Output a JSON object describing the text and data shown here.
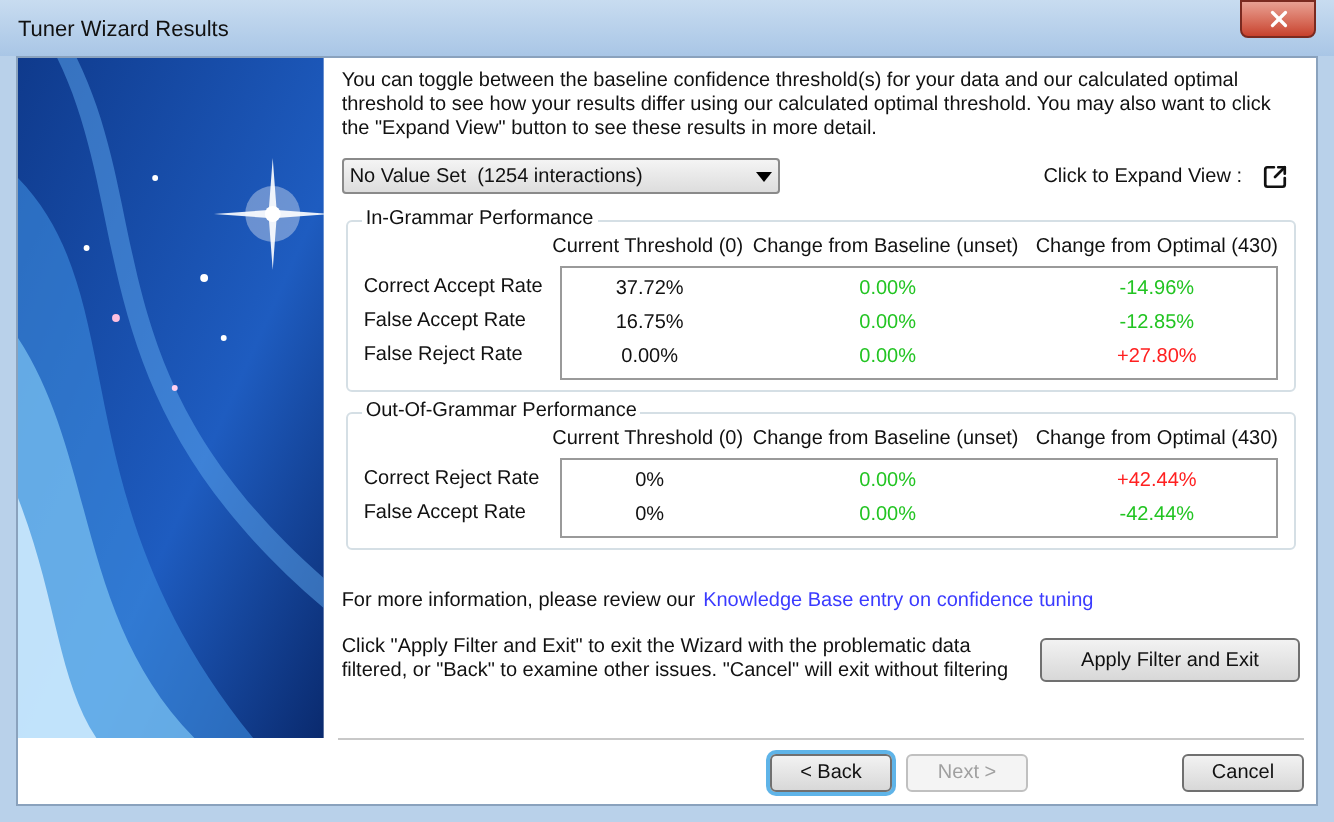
{
  "window": {
    "title": "Tuner Wizard Results"
  },
  "intro": "You can toggle between the baseline confidence threshold(s) for your data and our calculated optimal threshold to see how your results differ using our calculated optimal threshold. You may also want to click the \"Expand View\" button to see these results in more detail.",
  "dropdown": {
    "value": "No Value Set  (1254 interactions)"
  },
  "expand_label": "Click to Expand View :",
  "groups": [
    {
      "title": "In-Grammar Performance",
      "columns": [
        "Current Threshold (0)",
        "Change from Baseline (unset)",
        "Change from Optimal (430)"
      ],
      "rows": [
        {
          "label": "Correct Accept Rate",
          "cells": [
            {
              "text": "37.72%",
              "color": "#111111"
            },
            {
              "text": "0.00%",
              "color": "#22c422"
            },
            {
              "text": "-14.96%",
              "color": "#22c422"
            }
          ]
        },
        {
          "label": "False Accept Rate",
          "cells": [
            {
              "text": "16.75%",
              "color": "#111111"
            },
            {
              "text": "0.00%",
              "color": "#22c422"
            },
            {
              "text": "-12.85%",
              "color": "#22c422"
            }
          ]
        },
        {
          "label": "False Reject Rate",
          "cells": [
            {
              "text": "0.00%",
              "color": "#111111"
            },
            {
              "text": "0.00%",
              "color": "#22c422"
            },
            {
              "text": "+27.80%",
              "color": "#ff2020"
            }
          ]
        }
      ]
    },
    {
      "title": "Out-Of-Grammar Performance",
      "columns": [
        "Current Threshold (0)",
        "Change from Baseline (unset)",
        "Change from Optimal (430)"
      ],
      "rows": [
        {
          "label": "Correct Reject Rate",
          "cells": [
            {
              "text": "0%",
              "color": "#111111"
            },
            {
              "text": "0.00%",
              "color": "#22c422"
            },
            {
              "text": "+42.44%",
              "color": "#ff2020"
            }
          ]
        },
        {
          "label": "False Accept Rate",
          "cells": [
            {
              "text": "0%",
              "color": "#111111"
            },
            {
              "text": "0.00%",
              "color": "#22c422"
            },
            {
              "text": "-42.44%",
              "color": "#22c422"
            }
          ]
        }
      ]
    }
  ],
  "info": {
    "text": "For more information, please review our",
    "link": "Knowledge Base entry on confidence tuning"
  },
  "apply_note": "Click \"Apply Filter and Exit\" to exit the Wizard with the problematic data filtered, or \"Back\" to examine other issues. \"Cancel\" will exit without filtering",
  "apply_button": "Apply Filter and Exit",
  "nav_buttons": [
    {
      "label": "< Back",
      "disabled": false,
      "focused": true
    },
    {
      "label": "Next >",
      "disabled": true,
      "focused": false
    }
  ],
  "cancel_button": "Cancel"
}
